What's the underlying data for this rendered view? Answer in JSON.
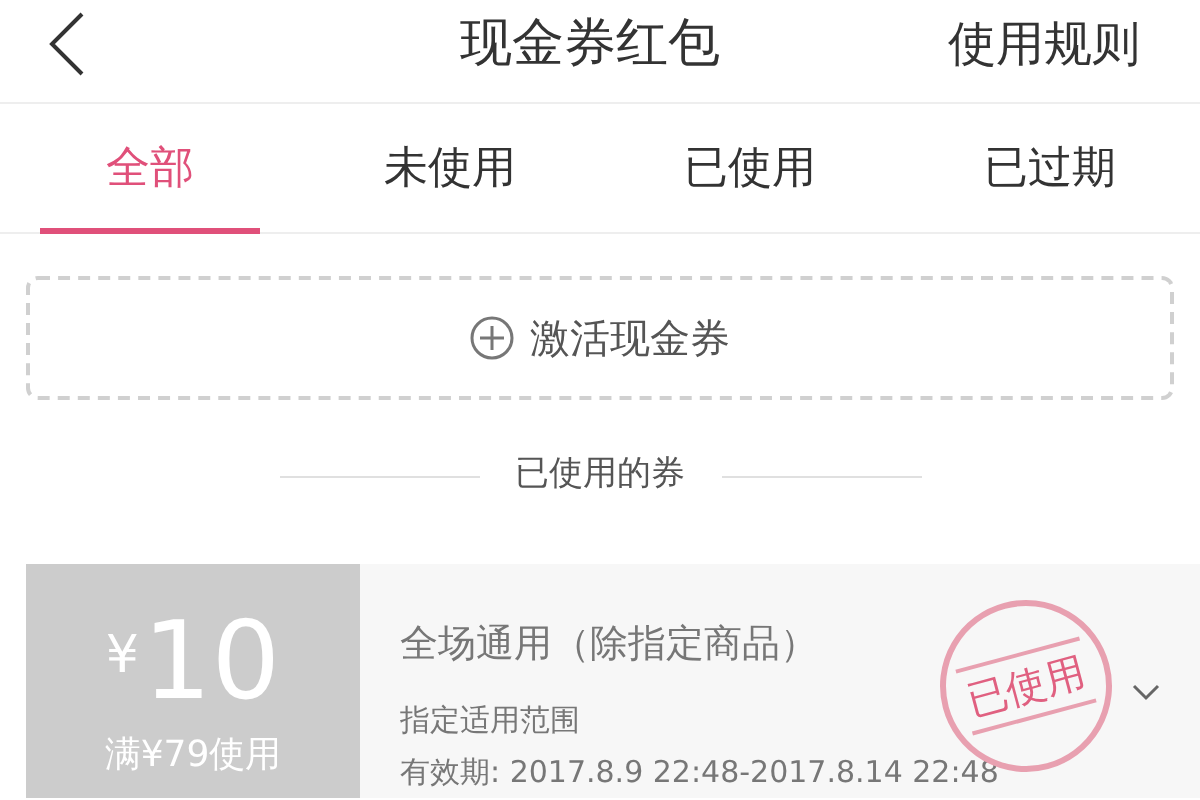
{
  "header": {
    "title": "现金券红包",
    "rules": "使用规则"
  },
  "tabs": [
    {
      "label": "全部",
      "selected": true
    },
    {
      "label": "未使用",
      "selected": false
    },
    {
      "label": "已使用",
      "selected": false
    },
    {
      "label": "已过期",
      "selected": false
    }
  ],
  "activate_button": {
    "label": "激活现金券"
  },
  "section_heading": "已使用的券",
  "coupons": [
    {
      "currency": "¥",
      "amount": "10",
      "condition": "满¥79使用",
      "title": "全场通用（除指定商品）",
      "scope": "指定适用范围",
      "validity": "有效期: 2017.8.9 22:48-2017.8.14 22:48",
      "stamp": "已使用",
      "used": true
    }
  ]
}
